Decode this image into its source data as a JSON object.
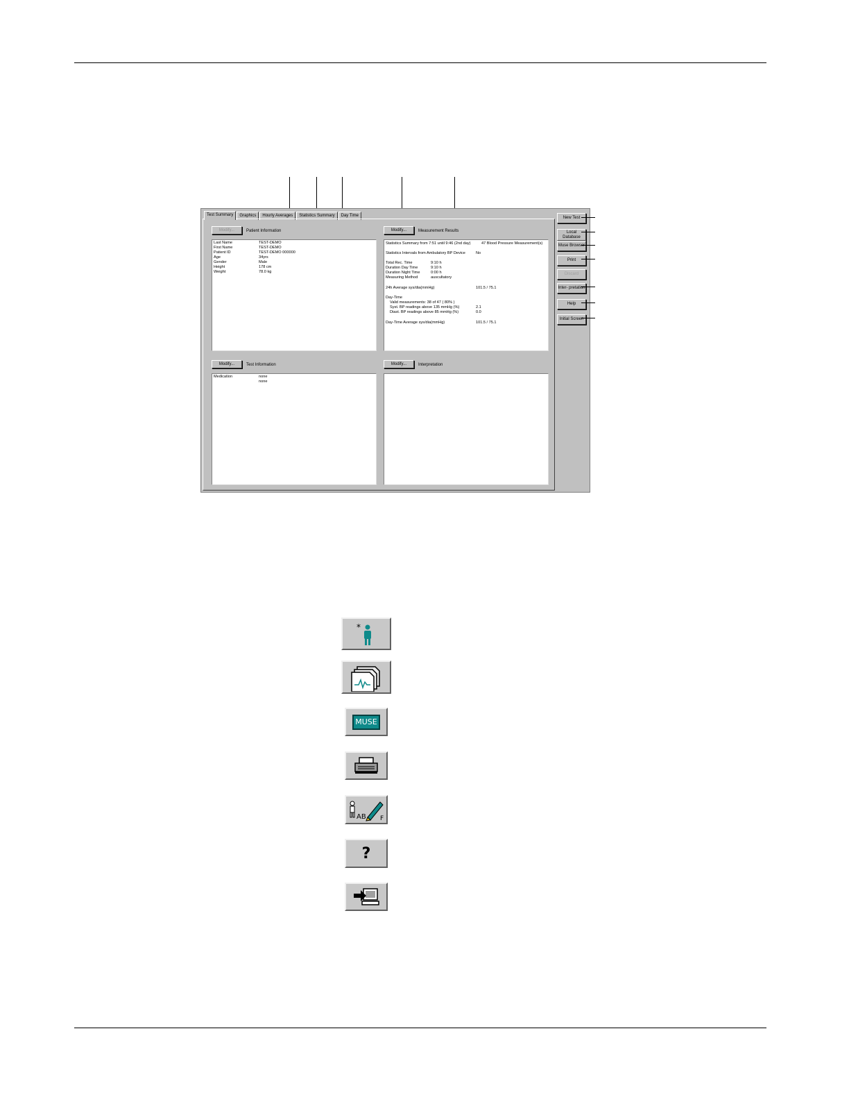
{
  "window": {
    "tabs": [
      "Test Summary",
      "Graphics",
      "Hourly Averages",
      "Statistics Summary",
      "Day Time"
    ],
    "modify_label": "Modify...",
    "patient": {
      "title": "Patient Information",
      "rows": [
        [
          "Last Name",
          "TEST-DEMO"
        ],
        [
          "First Name",
          "TEST-DEMO"
        ],
        [
          "Patient ID",
          "TEST-DEMO 000000"
        ],
        [
          "Age",
          "34yrs"
        ],
        [
          "Gender",
          "Male"
        ],
        [
          "Height",
          "178 cm"
        ],
        [
          "Weight",
          "78.0 kg"
        ]
      ]
    },
    "measurement": {
      "title": "Measurement Results",
      "summary_line": "Statistics Summary from 7:51 until 9:46 (2nd day)",
      "summary_count": "47 Blood Pressure Measurement(s)",
      "intervals_label": "Statistics Intervals from Ambulatory BP Device",
      "intervals_value": "No",
      "total_rec_label": "Total Rec. Time",
      "total_rec_value": "9:10 h",
      "day_dur_label": "Duration Day Time",
      "day_dur_value": "9:10 h",
      "night_dur_label": "Duration Night Time",
      "night_dur_value": "0:00 h",
      "method_label": "Measuring Method",
      "method_value": "auscultatory",
      "avg24_label": "24h Average sys/dia(mmHg)",
      "avg24_value": "101.5 / 75.1",
      "daytime_heading": "Day-Time",
      "valid_label": "Valid measurements: 38 of 47 ( 80% )",
      "syst_label": "Syst. BP readings above 135 mmHg (%)",
      "syst_value": "2.1",
      "diast_label": "Diast. BP readings above 85 mmHg (%)",
      "diast_value": "0.0",
      "dayavg_label": "Day-Time Average sys/dia(mmHg)",
      "dayavg_value": "101.5 / 75.1"
    },
    "test_info": {
      "title": "Test Information",
      "medication_label": "Medication",
      "medication_values": [
        "none",
        "none"
      ]
    },
    "interpretation": {
      "title": "Interpretation"
    },
    "side_buttons": {
      "new_test": "New Test",
      "local_db_1": "Local",
      "local_db_2": "Database",
      "muse": "Muse Browser",
      "print": "Print",
      "disabled": "Discard",
      "interp": "Inter- pretation",
      "help": "Help",
      "initial": "Initial Screen"
    }
  },
  "icons": {
    "muse_text": "MUSE",
    "question": "?",
    "ab_text": "AB",
    "f_text": "F"
  },
  "colors": {
    "teal": "#0e8a8a",
    "face": "#c0c0c0"
  }
}
